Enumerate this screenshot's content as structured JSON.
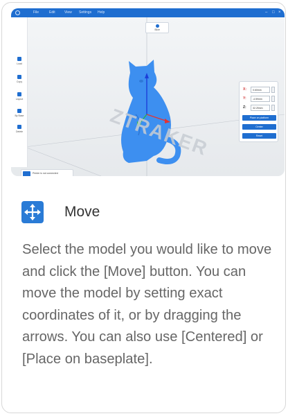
{
  "app": {
    "menu": [
      "File",
      "Edit",
      "View",
      "Settings",
      "Help"
    ],
    "window_controls": [
      "–",
      "□",
      "×"
    ],
    "toolbar": {
      "slice_label": "Slice"
    },
    "sidebar": [
      {
        "label": "Load",
        "icon": "load-icon"
      },
      {
        "label": "Copy",
        "icon": "copy-icon"
      },
      {
        "label": "Layout",
        "icon": "layout-icon"
      },
      {
        "label": "By Base",
        "icon": "by-base-icon"
      },
      {
        "label": "Delete",
        "icon": "delete-icon"
      }
    ],
    "move_panel": {
      "x_label": "X:",
      "x_value": "0.60mm",
      "y_label": "Y:",
      "y_value": "-4.59mm",
      "z_label": "Z:",
      "z_value": "32.25mm",
      "place_on_platform": "Place on platform",
      "center": "Center",
      "reset": "Reset"
    },
    "printer": {
      "status": "Printer is not connected",
      "sub": "--------"
    },
    "watermark": "ZTRAKER",
    "colors": {
      "accent": "#1f6ed0",
      "model": "#3d8ff0"
    }
  },
  "section": {
    "icon": "move-arrows-icon",
    "title": "Move",
    "description": "Select the model you would like to move and click the [Move] button. You can move the model by setting exact coordinates of it, or by dragging the arrows. You can also use [Centered] or [Place on baseplate]."
  }
}
